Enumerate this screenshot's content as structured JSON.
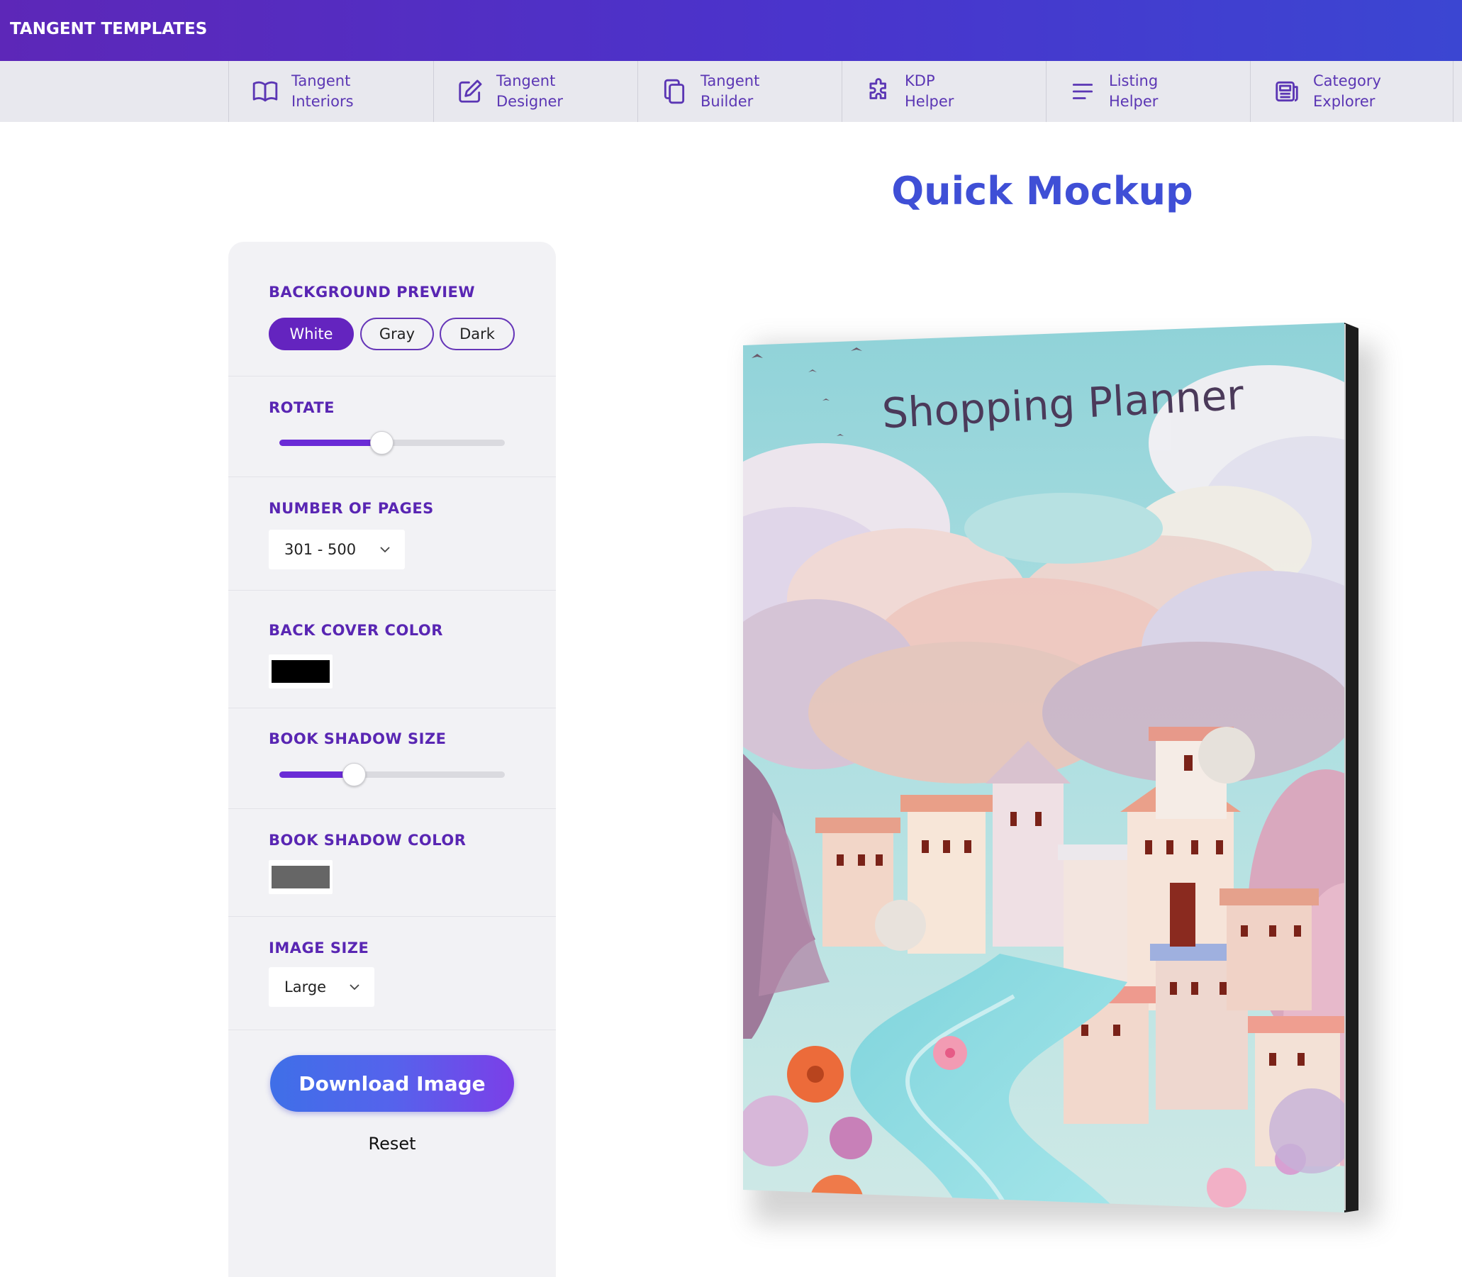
{
  "brand": {
    "name": "TANGENT TEMPLATES"
  },
  "nav": {
    "items": [
      {
        "label": "Tangent\nInteriors",
        "icon": "book-open-icon"
      },
      {
        "label": "Tangent\nDesigner",
        "icon": "edit-icon"
      },
      {
        "label": "Tangent\nBuilder",
        "icon": "copy-icon"
      },
      {
        "label": "KDP\nHelper",
        "icon": "puzzle-icon"
      },
      {
        "label": "Listing\nHelper",
        "icon": "lines-icon"
      },
      {
        "label": "Category\nExplorer",
        "icon": "newspaper-icon"
      }
    ]
  },
  "page": {
    "title": "Quick Mockup"
  },
  "controls": {
    "background_preview": {
      "label": "BACKGROUND PREVIEW",
      "options": [
        "White",
        "Gray",
        "Dark"
      ],
      "selected": "White"
    },
    "rotate": {
      "label": "ROTATE",
      "value_fraction": 0.45
    },
    "pages": {
      "label": "NUMBER OF PAGES",
      "value": "301 - 500"
    },
    "back_cover_color": {
      "label": "BACK COVER COLOR",
      "color": "#000000"
    },
    "shadow_size": {
      "label": "BOOK SHADOW SIZE",
      "value_fraction": 0.33
    },
    "shadow_color": {
      "label": "BOOK SHADOW COLOR",
      "color": "#666666"
    },
    "image_size": {
      "label": "IMAGE SIZE",
      "value": "Large"
    },
    "download_label": "Download Image",
    "reset_label": "Reset"
  },
  "book": {
    "cover_title": "Shopping Planner"
  },
  "colors": {
    "accent": "#5926b3",
    "title": "#3f4fd6"
  }
}
